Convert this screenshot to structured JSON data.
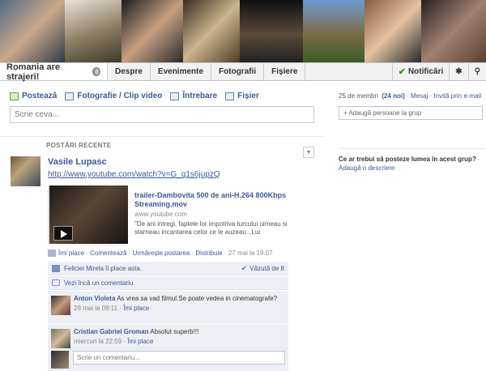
{
  "group": {
    "name": "Romania are strajeri!"
  },
  "tabs": [
    "Despre",
    "Evenimente",
    "Fotografii",
    "Fișiere"
  ],
  "nav_right": {
    "notifications": "Notificări"
  },
  "composer": {
    "actions": [
      "Postează",
      "Fotografie / Clip video",
      "Întrebare",
      "Fișier"
    ],
    "placeholder": "Scrie ceva..."
  },
  "feed": {
    "section_label": "POSTĂRI RECENTE"
  },
  "post": {
    "author": "Vasile Lupasc",
    "link": "http://www.youtube.com/watch?v=G_q1s6jupzQ",
    "share": {
      "title": "trailer-Dambovita 500 de ani-H.264 800Kbps Streaming.mov",
      "domain": "www.youtube.com",
      "excerpt": "\"De ani intregi, faptele lor impotriva turcului uimeau si starneau incantarea celor ce le auzeau...Lui"
    },
    "actions": {
      "like": "Îmi place",
      "comment": "Comentează",
      "follow": "Urmărește postarea",
      "share": "Distribuie",
      "time": "27 mai la 19:07"
    },
    "likes_text": "Feliciei Mirela îi place asta.",
    "seen_text": "Văzută de 8",
    "more_comments": "Vezi încă un comentariu",
    "comments": [
      {
        "author": "Anton Violeta",
        "text": "As vrea sa vad filmul.Se poate vedea in cinematografe?",
        "time": "28 mai la 09:11",
        "like": "Îmi place"
      },
      {
        "author": "Cristian Gabriel Groman",
        "text": "Absolut superb!!!",
        "time": "miercuri la 22:59",
        "like": "Îmi place"
      }
    ],
    "reply_placeholder": "Scrie un comentariu..."
  },
  "sidebar": {
    "member_count": "25 de membri",
    "new_count": "(24 noi)",
    "message": "Mesaj",
    "invite": "Invită prin e-mail",
    "add_people": "+ Adaugă persoane la grup",
    "description_prompt": "Ce ar trebui să posteze lumea în acest grup?",
    "add_description": "Adaugă o descriere"
  },
  "colors": {
    "link": "#3b5998",
    "nav_bg": "#f2f2f2",
    "comment_bg": "#edeff4"
  }
}
